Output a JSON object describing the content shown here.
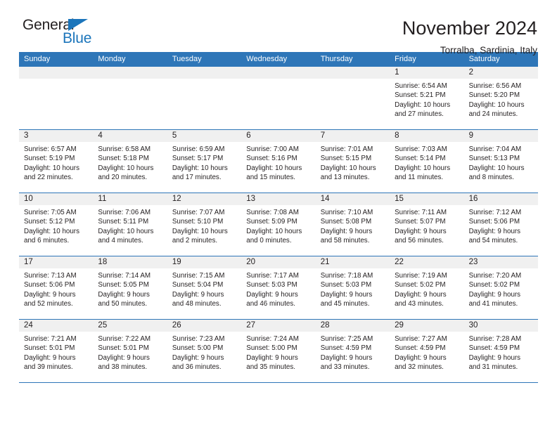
{
  "logo": {
    "word_one": "General",
    "word_two": "Blue",
    "accent_color": "#1b75bb",
    "triangle_icon": "triangle-icon"
  },
  "header": {
    "title": "November 2024",
    "subtitle": "Torralba, Sardinia, Italy"
  },
  "theme": {
    "header_blue": "#2e76b8",
    "daynum_gray": "#f0f0f0",
    "text_color": "#231f20"
  },
  "weekdays": [
    "Sunday",
    "Monday",
    "Tuesday",
    "Wednesday",
    "Thursday",
    "Friday",
    "Saturday"
  ],
  "weeks": [
    [
      {
        "day": "",
        "sunrise": "",
        "sunset": "",
        "daylight_line1": "",
        "daylight_line2": "",
        "empty": true
      },
      {
        "day": "",
        "sunrise": "",
        "sunset": "",
        "daylight_line1": "",
        "daylight_line2": "",
        "empty": true
      },
      {
        "day": "",
        "sunrise": "",
        "sunset": "",
        "daylight_line1": "",
        "daylight_line2": "",
        "empty": true
      },
      {
        "day": "",
        "sunrise": "",
        "sunset": "",
        "daylight_line1": "",
        "daylight_line2": "",
        "empty": true
      },
      {
        "day": "",
        "sunrise": "",
        "sunset": "",
        "daylight_line1": "",
        "daylight_line2": "",
        "empty": true
      },
      {
        "day": "1",
        "sunrise": "Sunrise: 6:54 AM",
        "sunset": "Sunset: 5:21 PM",
        "daylight_line1": "Daylight: 10 hours",
        "daylight_line2": "and 27 minutes."
      },
      {
        "day": "2",
        "sunrise": "Sunrise: 6:56 AM",
        "sunset": "Sunset: 5:20 PM",
        "daylight_line1": "Daylight: 10 hours",
        "daylight_line2": "and 24 minutes."
      }
    ],
    [
      {
        "day": "3",
        "sunrise": "Sunrise: 6:57 AM",
        "sunset": "Sunset: 5:19 PM",
        "daylight_line1": "Daylight: 10 hours",
        "daylight_line2": "and 22 minutes."
      },
      {
        "day": "4",
        "sunrise": "Sunrise: 6:58 AM",
        "sunset": "Sunset: 5:18 PM",
        "daylight_line1": "Daylight: 10 hours",
        "daylight_line2": "and 20 minutes."
      },
      {
        "day": "5",
        "sunrise": "Sunrise: 6:59 AM",
        "sunset": "Sunset: 5:17 PM",
        "daylight_line1": "Daylight: 10 hours",
        "daylight_line2": "and 17 minutes."
      },
      {
        "day": "6",
        "sunrise": "Sunrise: 7:00 AM",
        "sunset": "Sunset: 5:16 PM",
        "daylight_line1": "Daylight: 10 hours",
        "daylight_line2": "and 15 minutes."
      },
      {
        "day": "7",
        "sunrise": "Sunrise: 7:01 AM",
        "sunset": "Sunset: 5:15 PM",
        "daylight_line1": "Daylight: 10 hours",
        "daylight_line2": "and 13 minutes."
      },
      {
        "day": "8",
        "sunrise": "Sunrise: 7:03 AM",
        "sunset": "Sunset: 5:14 PM",
        "daylight_line1": "Daylight: 10 hours",
        "daylight_line2": "and 11 minutes."
      },
      {
        "day": "9",
        "sunrise": "Sunrise: 7:04 AM",
        "sunset": "Sunset: 5:13 PM",
        "daylight_line1": "Daylight: 10 hours",
        "daylight_line2": "and 8 minutes."
      }
    ],
    [
      {
        "day": "10",
        "sunrise": "Sunrise: 7:05 AM",
        "sunset": "Sunset: 5:12 PM",
        "daylight_line1": "Daylight: 10 hours",
        "daylight_line2": "and 6 minutes."
      },
      {
        "day": "11",
        "sunrise": "Sunrise: 7:06 AM",
        "sunset": "Sunset: 5:11 PM",
        "daylight_line1": "Daylight: 10 hours",
        "daylight_line2": "and 4 minutes."
      },
      {
        "day": "12",
        "sunrise": "Sunrise: 7:07 AM",
        "sunset": "Sunset: 5:10 PM",
        "daylight_line1": "Daylight: 10 hours",
        "daylight_line2": "and 2 minutes."
      },
      {
        "day": "13",
        "sunrise": "Sunrise: 7:08 AM",
        "sunset": "Sunset: 5:09 PM",
        "daylight_line1": "Daylight: 10 hours",
        "daylight_line2": "and 0 minutes."
      },
      {
        "day": "14",
        "sunrise": "Sunrise: 7:10 AM",
        "sunset": "Sunset: 5:08 PM",
        "daylight_line1": "Daylight: 9 hours",
        "daylight_line2": "and 58 minutes."
      },
      {
        "day": "15",
        "sunrise": "Sunrise: 7:11 AM",
        "sunset": "Sunset: 5:07 PM",
        "daylight_line1": "Daylight: 9 hours",
        "daylight_line2": "and 56 minutes."
      },
      {
        "day": "16",
        "sunrise": "Sunrise: 7:12 AM",
        "sunset": "Sunset: 5:06 PM",
        "daylight_line1": "Daylight: 9 hours",
        "daylight_line2": "and 54 minutes."
      }
    ],
    [
      {
        "day": "17",
        "sunrise": "Sunrise: 7:13 AM",
        "sunset": "Sunset: 5:06 PM",
        "daylight_line1": "Daylight: 9 hours",
        "daylight_line2": "and 52 minutes."
      },
      {
        "day": "18",
        "sunrise": "Sunrise: 7:14 AM",
        "sunset": "Sunset: 5:05 PM",
        "daylight_line1": "Daylight: 9 hours",
        "daylight_line2": "and 50 minutes."
      },
      {
        "day": "19",
        "sunrise": "Sunrise: 7:15 AM",
        "sunset": "Sunset: 5:04 PM",
        "daylight_line1": "Daylight: 9 hours",
        "daylight_line2": "and 48 minutes."
      },
      {
        "day": "20",
        "sunrise": "Sunrise: 7:17 AM",
        "sunset": "Sunset: 5:03 PM",
        "daylight_line1": "Daylight: 9 hours",
        "daylight_line2": "and 46 minutes."
      },
      {
        "day": "21",
        "sunrise": "Sunrise: 7:18 AM",
        "sunset": "Sunset: 5:03 PM",
        "daylight_line1": "Daylight: 9 hours",
        "daylight_line2": "and 45 minutes."
      },
      {
        "day": "22",
        "sunrise": "Sunrise: 7:19 AM",
        "sunset": "Sunset: 5:02 PM",
        "daylight_line1": "Daylight: 9 hours",
        "daylight_line2": "and 43 minutes."
      },
      {
        "day": "23",
        "sunrise": "Sunrise: 7:20 AM",
        "sunset": "Sunset: 5:02 PM",
        "daylight_line1": "Daylight: 9 hours",
        "daylight_line2": "and 41 minutes."
      }
    ],
    [
      {
        "day": "24",
        "sunrise": "Sunrise: 7:21 AM",
        "sunset": "Sunset: 5:01 PM",
        "daylight_line1": "Daylight: 9 hours",
        "daylight_line2": "and 39 minutes."
      },
      {
        "day": "25",
        "sunrise": "Sunrise: 7:22 AM",
        "sunset": "Sunset: 5:01 PM",
        "daylight_line1": "Daylight: 9 hours",
        "daylight_line2": "and 38 minutes."
      },
      {
        "day": "26",
        "sunrise": "Sunrise: 7:23 AM",
        "sunset": "Sunset: 5:00 PM",
        "daylight_line1": "Daylight: 9 hours",
        "daylight_line2": "and 36 minutes."
      },
      {
        "day": "27",
        "sunrise": "Sunrise: 7:24 AM",
        "sunset": "Sunset: 5:00 PM",
        "daylight_line1": "Daylight: 9 hours",
        "daylight_line2": "and 35 minutes."
      },
      {
        "day": "28",
        "sunrise": "Sunrise: 7:25 AM",
        "sunset": "Sunset: 4:59 PM",
        "daylight_line1": "Daylight: 9 hours",
        "daylight_line2": "and 33 minutes."
      },
      {
        "day": "29",
        "sunrise": "Sunrise: 7:27 AM",
        "sunset": "Sunset: 4:59 PM",
        "daylight_line1": "Daylight: 9 hours",
        "daylight_line2": "and 32 minutes."
      },
      {
        "day": "30",
        "sunrise": "Sunrise: 7:28 AM",
        "sunset": "Sunset: 4:59 PM",
        "daylight_line1": "Daylight: 9 hours",
        "daylight_line2": "and 31 minutes."
      }
    ]
  ]
}
